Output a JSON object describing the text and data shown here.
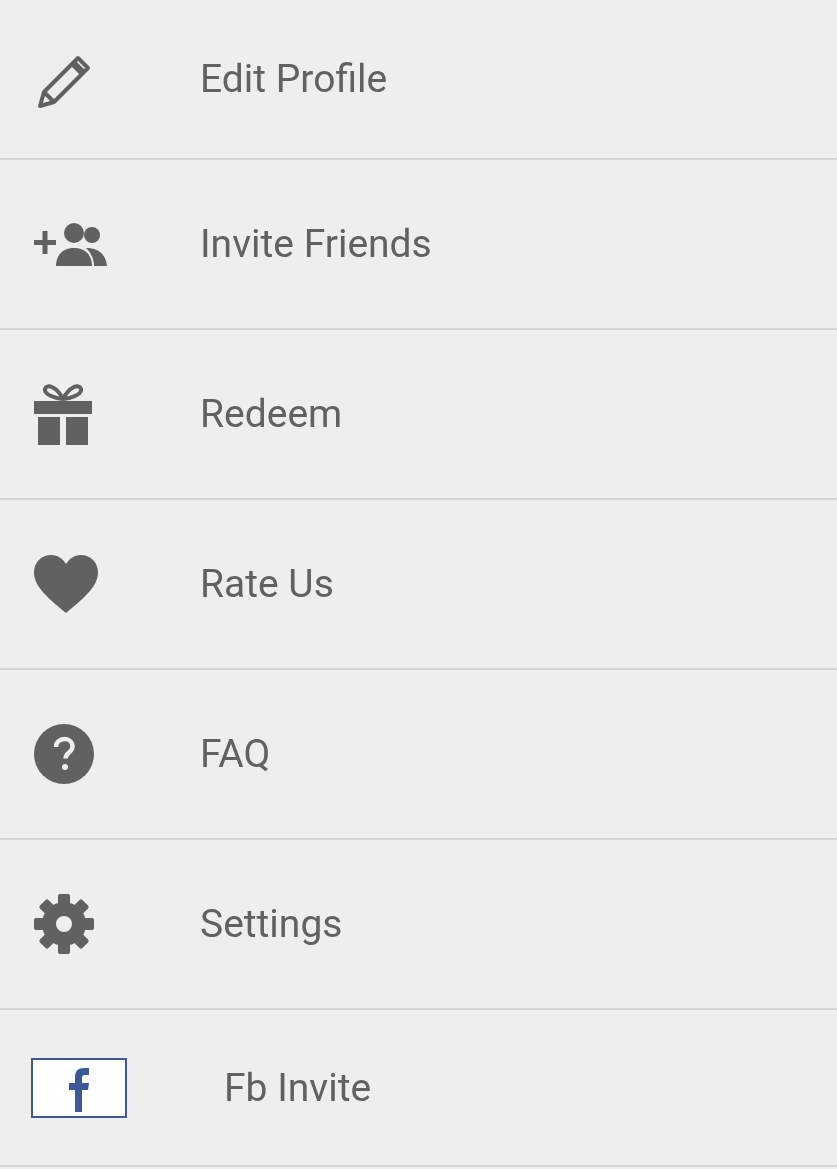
{
  "menu": {
    "items": [
      {
        "label": "Edit Profile",
        "kind": "menu"
      },
      {
        "label": "Invite Friends",
        "kind": "menu"
      },
      {
        "label": "Redeem",
        "kind": "menu"
      },
      {
        "label": "Rate Us",
        "kind": "menu"
      },
      {
        "label": "FAQ",
        "kind": "menu"
      },
      {
        "label": "Settings",
        "kind": "menu"
      },
      {
        "label": "Fb Invite",
        "kind": "facebook"
      }
    ]
  }
}
